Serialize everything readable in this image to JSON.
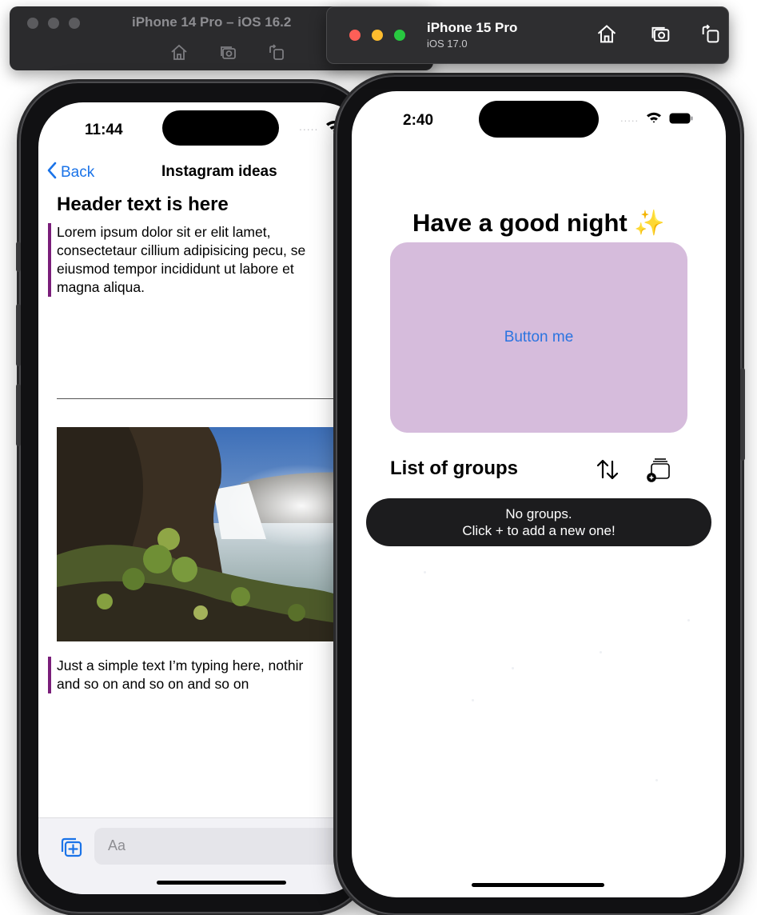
{
  "simulator_back": {
    "title": "iPhone 14 Pro – iOS 16.2"
  },
  "simulator_front": {
    "title": "iPhone 15 Pro",
    "subtitle": "iOS 17.0"
  },
  "toolbar_icons": [
    "home-icon",
    "screenshot-icon",
    "rotate-icon"
  ],
  "window_controls": {
    "close_color": "#ff5f57",
    "minimize_color": "#febc2e",
    "zoom_color": "#28c840"
  },
  "left_phone": {
    "status": {
      "time": "11:44"
    },
    "nav": {
      "back_label": "Back",
      "title": "Instagram ideas"
    },
    "article": {
      "header": "Header text is here",
      "quote_lines": [
        "Lorem ipsum dolor sit er elit lamet,",
        "consectetaur cillium adipisicing pecu, se",
        "eiusmod tempor incididunt ut labore et",
        "magna aliqua."
      ],
      "second_quote_lines": [
        "Just a simple text I’m typing here, nothir",
        "and so on and so on and so on"
      ]
    },
    "compose": {
      "placeholder": "Aa"
    },
    "accent_color": "#7a1e7a"
  },
  "right_phone": {
    "status": {
      "time": "2:40"
    },
    "greeting": "Have a good night ✨",
    "main_button_label": "Button me",
    "main_button_color": "#d6bcdc",
    "list_title": "List of groups",
    "empty_state": {
      "line1": "No groups.",
      "line2": "Click + to add a new one!"
    }
  }
}
